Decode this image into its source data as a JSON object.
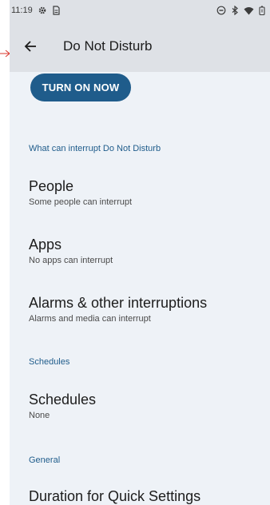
{
  "status_bar": {
    "time": "11:19",
    "left_icons": [
      "gear-icon",
      "sim-icon"
    ],
    "right_icons": [
      "dnd-status-icon",
      "bluetooth-icon",
      "wifi-icon",
      "battery-icon"
    ]
  },
  "app_bar": {
    "title": "Do Not Disturb",
    "back_icon": "arrow-back-icon"
  },
  "turn_on_button": {
    "label": "TURN ON NOW"
  },
  "sections": {
    "interrupt": {
      "header": "What can interrupt Do Not Disturb",
      "items": [
        {
          "title": "People",
          "subtitle": "Some people can interrupt"
        },
        {
          "title": "Apps",
          "subtitle": "No apps can interrupt"
        },
        {
          "title": "Alarms & other interruptions",
          "subtitle": "Alarms and media can interrupt"
        }
      ]
    },
    "schedules": {
      "header": "Schedules",
      "items": [
        {
          "title": "Schedules",
          "subtitle": "None"
        }
      ]
    },
    "general": {
      "header": "General",
      "items": [
        {
          "title": "Duration for Quick Settings",
          "subtitle": ""
        }
      ]
    }
  },
  "colors": {
    "accent": "#1f5c8b",
    "bar_background": "#dee1e6",
    "page_background": "#eef2f7",
    "pointer_arrow": "#d9342b"
  }
}
